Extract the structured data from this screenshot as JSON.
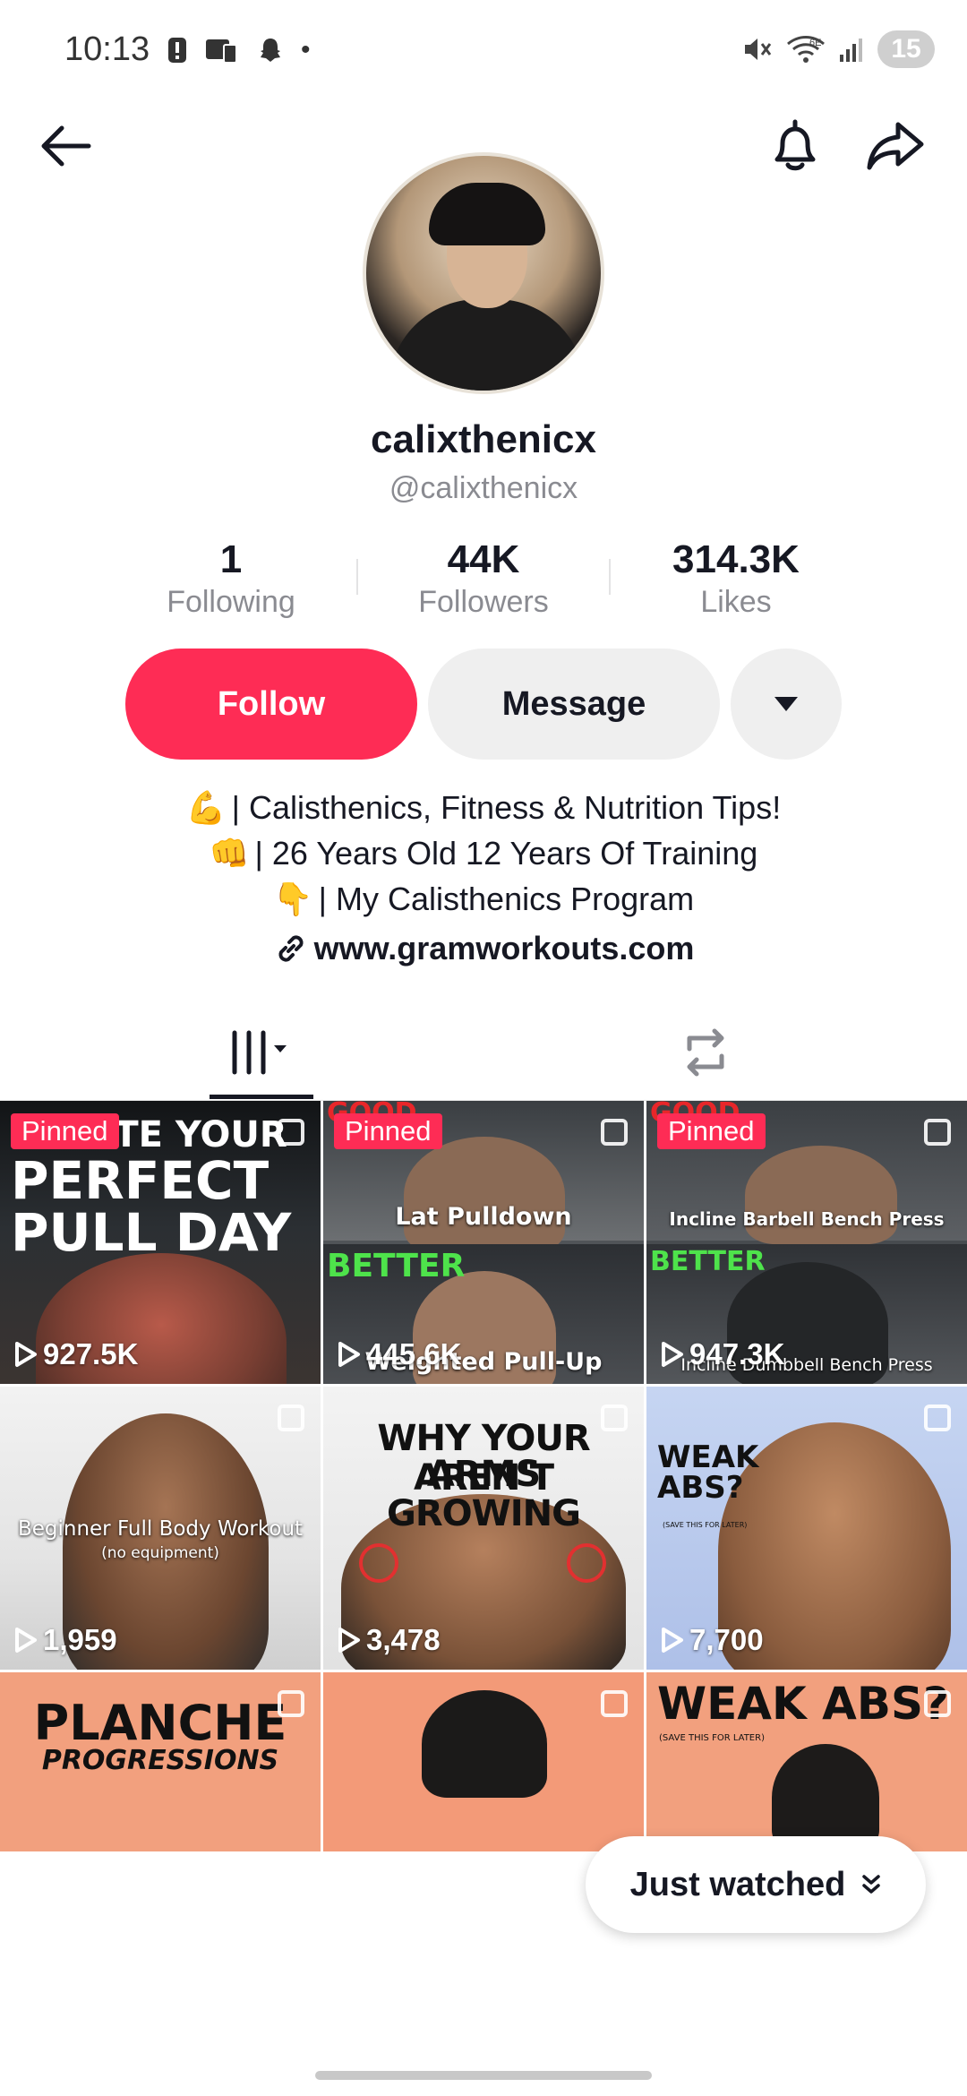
{
  "status_bar": {
    "time": "10:13",
    "battery": "15",
    "network": "6E"
  },
  "profile": {
    "display_name": "calixthenicx",
    "handle": "@calixthenicx",
    "stats": [
      {
        "value": "1",
        "label": "Following"
      },
      {
        "value": "44K",
        "label": "Followers"
      },
      {
        "value": "314.3K",
        "label": "Likes"
      }
    ],
    "follow_label": "Follow",
    "message_label": "Message",
    "bio": [
      {
        "emoji": "💪",
        "text": "| Calisthenics, Fitness & Nutrition Tips!"
      },
      {
        "emoji": "👊",
        "text": "| 26 Years Old 12 Years Of Training"
      },
      {
        "emoji": "👇",
        "text": "| My Calisthenics Program"
      }
    ],
    "link": "www.gramworkouts.com"
  },
  "colors": {
    "accent": "#fe2c55",
    "secondary_button": "#efefef",
    "muted_text": "#8a8b91"
  },
  "videos": [
    {
      "pinned_label": "Pinned",
      "title": "PERFECT PULL DAY",
      "title_top": "CREATE YOUR",
      "views": "927.5K"
    },
    {
      "pinned_label": "Pinned",
      "tag_top": "GOOD",
      "caption_top": "Lat Pulldown",
      "tag_bottom": "BETTER",
      "caption_bottom": "Weighted Pull-Up",
      "views": "445.6K"
    },
    {
      "pinned_label": "Pinned",
      "tag_top": "GOOD",
      "caption_top": "Incline Barbell Bench Press",
      "tag_bottom": "BETTER",
      "caption_bottom": "Incline Dumbbell Bench Press",
      "views": "947.3K"
    },
    {
      "title": "Beginner Full Body Workout",
      "subtitle": "(no equipment)",
      "views": "1,959"
    },
    {
      "title_line1": "WHY YOUR ARMS",
      "title_line2": "AREN'T GROWING",
      "views": "3,478"
    },
    {
      "title": "WEAK ABS?",
      "subtitle": "(SAVE THIS FOR LATER)",
      "views": "7,700"
    },
    {
      "title": "PLANCHE",
      "subtitle": "PROGRESSIONS"
    },
    {
      "title": ""
    },
    {
      "title": "WEAK ABS?",
      "subtitle": "(SAVE THIS FOR LATER)"
    }
  ],
  "just_watched": {
    "label": "Just watched"
  }
}
